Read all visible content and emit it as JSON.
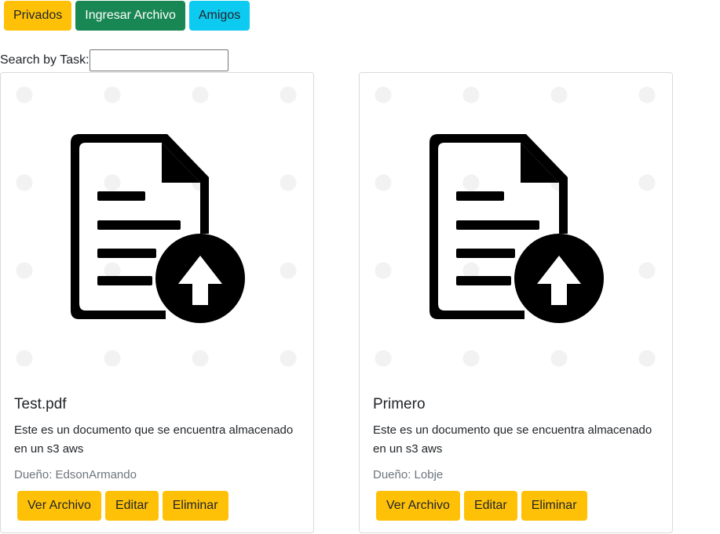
{
  "toolbar": {
    "privados_label": "Privados",
    "ingresar_label": "Ingresar Archivo",
    "amigos_label": "Amigos"
  },
  "search": {
    "label": "Search by Task:",
    "value": "",
    "placeholder": ""
  },
  "cards": [
    {
      "title": "Test.pdf",
      "description": "Este es un documento que se encuentra almacenado en un s3 aws",
      "owner": "Dueño: EdsonArmando",
      "view_label": "Ver Archivo",
      "edit_label": "Editar",
      "delete_label": "Eliminar",
      "image_icon": "file-upload-icon"
    },
    {
      "title": "Primero",
      "description": "Este es un documento que se encuentra almacenado en un s3 aws",
      "owner": "Dueño: Lobje",
      "view_label": "Ver Archivo",
      "edit_label": "Editar",
      "delete_label": "Eliminar",
      "image_icon": "file-upload-icon"
    }
  ],
  "colors": {
    "warning": "#ffc107",
    "success": "#198754",
    "info": "#0dcaf0"
  }
}
